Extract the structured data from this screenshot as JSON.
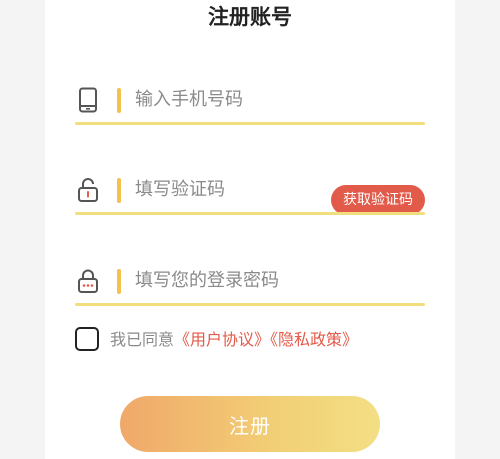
{
  "page": {
    "title": "注册账号"
  },
  "form": {
    "phone": {
      "icon": "phone-icon",
      "value": "",
      "placeholder": "输入手机号码"
    },
    "code": {
      "icon": "unlock-icon",
      "value": "",
      "placeholder": "填写验证码",
      "button_label": "获取验证码"
    },
    "password": {
      "icon": "lock-icon",
      "value": "",
      "placeholder": "填写您的登录密码"
    }
  },
  "agreement": {
    "checked": false,
    "prefix": "我已同意",
    "user_agreement": "《用户协议》",
    "privacy_policy": "《隐私政策》"
  },
  "actions": {
    "register_label": "注册"
  },
  "colors": {
    "accent_yellow": "#f2c14e",
    "underline": "#f2de7e",
    "link_red": "#e25a4a",
    "button_gradient_start": "#f0a86a",
    "button_gradient_end": "#f3df84"
  }
}
